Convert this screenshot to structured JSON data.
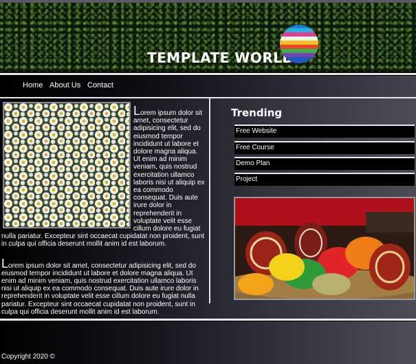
{
  "header": {
    "title": "TEMPLATE WORLD",
    "logo_icon": "rainbow-striped-globe-icon"
  },
  "nav": {
    "items": [
      {
        "label": "Home"
      },
      {
        "label": "About Us"
      },
      {
        "label": "Contact"
      }
    ]
  },
  "content": {
    "image1": "daisy-flowers-photo",
    "paragraph1": {
      "dropcap": "L",
      "text": "orem ipsum dolor sit amet, consectetur adipisicing elit, sed do eiusmod tempor incididunt ut labore et dolore magna aliqua. Ut enim ad minim veniam, quis nostrud exercitation ullamco laboris nisi ut aliquip ex ea commodo consequat. Duis aute irure dolor in reprehenderit in voluptate velit esse cillum dolore eu fugiat nulla pariatur. Excepteur sint occaecat cupidatat non proident, sunt in culpa qui officia deserunt mollit anim id est laborum."
    },
    "paragraph2": {
      "dropcap": "L",
      "text": "orem ipsum dolor sit amet, consectetur adipisicing elit, sed do eiusmod tempor incididunt ut labore et dolore magna aliqua. Ut enim ad minim veniam, quis nostrud exercitation ullamco laboris nisi ut aliquip ex ea commodo consequat. Duis aute irure dolor in reprehenderit in voluptate velit esse cillum dolore eu fugiat nulla pariatur. Excepteur sint occaecat cupidatat non proident, sunt in culpa qui officia deserunt mollit anim id est laborum."
    }
  },
  "sidebar": {
    "title": "Trending",
    "items": [
      {
        "label": "Free Website"
      },
      {
        "label": "Free Course"
      },
      {
        "label": "Demo Plan"
      },
      {
        "label": "Project"
      }
    ],
    "image": "easter-eggs-basket-photo"
  },
  "footer": {
    "copyright": "Copyright 2020 ©"
  },
  "colors": {
    "rule": "#e8e8e8",
    "background": "#000000"
  }
}
